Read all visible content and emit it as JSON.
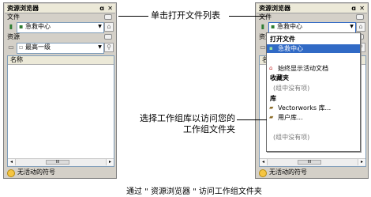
{
  "panel_title": "资源浏览器",
  "title_controls": {
    "pin": "ɑ",
    "close": "✕"
  },
  "sections": {
    "file": "文件",
    "resource": "资源"
  },
  "file_combo": "急救中心",
  "resource_combo": "最高一级",
  "home_icon": "⌂",
  "search_icon": "⚲",
  "list_header": "名称",
  "scroll": {
    "left": "◂",
    "right": "▸",
    "thumb": "III"
  },
  "status_text": "无活动的符号",
  "callout_top": "单击打开文件列表",
  "callout_bottom": [
    "选择工作组库以访问您的",
    "工作组文件夹"
  ],
  "dropdown": {
    "open_files_header": "打开文件",
    "open_file_item": "急救中心",
    "always_show_item": "始终显示活动文档",
    "favorites_header": "收藏夹",
    "favorites_empty": "(组中没有项)",
    "library_header": "库",
    "library_items": [
      "Vectorworks 库...",
      "用户库..."
    ],
    "library_empty": "(组中没有项)"
  },
  "caption": "通过 \" 资源浏览器 \" 访问工作组文件夹"
}
